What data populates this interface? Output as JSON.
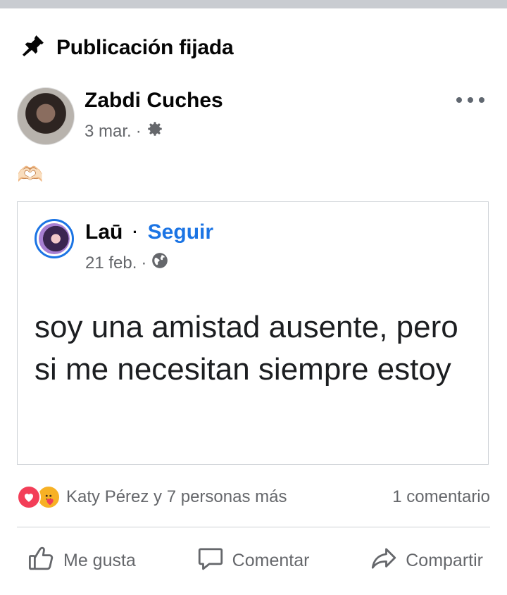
{
  "pinned": {
    "label": "Publicación fijada",
    "icon": "pin-icon"
  },
  "post": {
    "author": "Zabdi Cuches",
    "time": "3 mar.",
    "separator": "·",
    "privacy_icon": "gear-icon",
    "body_emoji": "🫶🏻"
  },
  "shared": {
    "author": "Laū",
    "separator": "·",
    "follow_label": "Seguir",
    "time": "21 feb.",
    "privacy_icon": "globe-icon",
    "text": "soy una amistad ausente, pero si me necesitan siempre estoy"
  },
  "reactions": {
    "icons": [
      "love-reaction-icon",
      "care-reaction-icon"
    ],
    "summary": "Katy Pérez y 7 personas más",
    "comments": "1 comentario"
  },
  "actions": {
    "like": "Me gusta",
    "comment": "Comentar",
    "share": "Compartir"
  },
  "colors": {
    "accent": "#1b74e4",
    "muted": "#65676b",
    "love": "#f33e58",
    "care": "#f7b125"
  }
}
